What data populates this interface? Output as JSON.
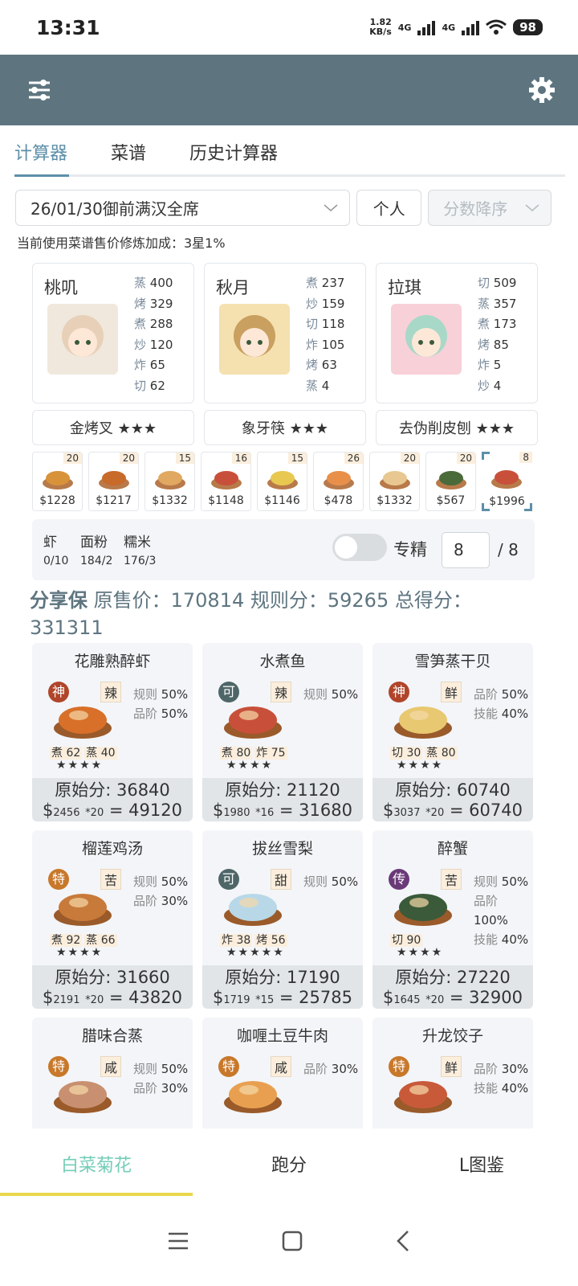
{
  "status": {
    "time": "13:31",
    "speed": "1.82",
    "speed_unit": "KB/s",
    "net1": "4G",
    "net2": "4G",
    "wifi_num": "6",
    "battery": "98"
  },
  "tabs": [
    "计算器",
    "菜谱",
    "历史计算器"
  ],
  "controls": {
    "rule": "26/01/30御前满汉全席",
    "mode": "个人",
    "sort": "分数降序"
  },
  "note": "当前使用菜谱售价修炼加成：3星1%",
  "chefs": [
    {
      "name": "桃叽",
      "skills": [
        [
          "蒸",
          "400"
        ],
        [
          "烤",
          "329"
        ],
        [
          "煮",
          "288"
        ],
        [
          "炒",
          "120"
        ],
        [
          "炸",
          "65"
        ],
        [
          "切",
          "62"
        ]
      ]
    },
    {
      "name": "秋月",
      "skills": [
        [
          "煮",
          "237"
        ],
        [
          "炒",
          "159"
        ],
        [
          "切",
          "118"
        ],
        [
          "炸",
          "105"
        ],
        [
          "烤",
          "63"
        ],
        [
          "蒸",
          "4"
        ]
      ]
    },
    {
      "name": "拉琪",
      "skills": [
        [
          "切",
          "509"
        ],
        [
          "蒸",
          "357"
        ],
        [
          "煮",
          "173"
        ],
        [
          "烤",
          "85"
        ],
        [
          "炸",
          "5"
        ],
        [
          "炒",
          "4"
        ]
      ]
    }
  ],
  "equips": [
    "金烤叉 ★★★",
    "象牙筷 ★★★",
    "去伪削皮刨 ★★★"
  ],
  "dishes": [
    {
      "count": "20",
      "price": "$1228"
    },
    {
      "count": "20",
      "price": "$1217"
    },
    {
      "count": "15",
      "price": "$1332"
    },
    {
      "count": "16",
      "price": "$1148"
    },
    {
      "count": "15",
      "price": "$1146"
    },
    {
      "count": "26",
      "price": "$478"
    },
    {
      "count": "20",
      "price": "$1332"
    },
    {
      "count": "20",
      "price": "$567"
    },
    {
      "count": "8",
      "price": "$1996"
    }
  ],
  "materials": [
    {
      "name": "虾",
      "count": "0/10"
    },
    {
      "name": "面粉",
      "count": "184/2"
    },
    {
      "name": "糯米",
      "count": "176/3"
    }
  ],
  "specialize": {
    "label": "专精",
    "value": "8",
    "max": "/ 8"
  },
  "summary": {
    "prefix": "分享保",
    "text": " 原售价：170814 规则分：59265 总得分：331311"
  },
  "recipes": [
    {
      "name": "花雕熟醉虾",
      "badge": "神",
      "badge_color": "#b0452a",
      "flavor": "辣",
      "tags": [
        [
          "规则",
          "50%"
        ],
        [
          "品阶",
          "50%"
        ]
      ],
      "skills": [
        "煮 62",
        "蒸 40"
      ],
      "stars": "★★★★",
      "raw": "原始分: 36840",
      "unit": "2456",
      "mult": "*20",
      "total": "49120"
    },
    {
      "name": "水煮鱼",
      "badge": "可",
      "badge_color": "#4e6668",
      "flavor": "辣",
      "tags": [
        [
          "规则",
          "50%"
        ]
      ],
      "skills": [
        "煮 80",
        "炸 75"
      ],
      "stars": "★★★★",
      "raw": "原始分: 21120",
      "unit": "1980",
      "mult": "*16",
      "total": "31680"
    },
    {
      "name": "雪笋蒸干贝",
      "badge": "神",
      "badge_color": "#b0452a",
      "flavor": "鲜",
      "tags": [
        [
          "品阶",
          "50%"
        ],
        [
          "技能",
          "40%"
        ]
      ],
      "skills": [
        "切 30",
        "蒸 80"
      ],
      "stars": "★★★★",
      "raw": "原始分: 60740",
      "unit": "3037",
      "mult": "*20",
      "total": "60740"
    },
    {
      "name": "榴莲鸡汤",
      "badge": "特",
      "badge_color": "#c8782a",
      "flavor": "苦",
      "tags": [
        [
          "规则",
          "50%"
        ],
        [
          "品阶",
          "30%"
        ]
      ],
      "skills": [
        "煮 92",
        "蒸 66"
      ],
      "stars": "★★★★",
      "raw": "原始分: 31660",
      "unit": "2191",
      "mult": "*20",
      "total": "43820"
    },
    {
      "name": "拔丝雪梨",
      "badge": "可",
      "badge_color": "#4e6668",
      "flavor": "甜",
      "tags": [
        [
          "规则",
          "50%"
        ]
      ],
      "skills": [
        "炸 38",
        "烤 56"
      ],
      "stars": "★★★★★",
      "raw": "原始分: 17190",
      "unit": "1719",
      "mult": "*15",
      "total": "25785"
    },
    {
      "name": "醉蟹",
      "badge": "传",
      "badge_color": "#6a3a78",
      "flavor": "苦",
      "tags": [
        [
          "规则",
          "50%"
        ],
        [
          "品阶",
          "100%"
        ],
        [
          "技能",
          "40%"
        ]
      ],
      "skills": [
        "切 90"
      ],
      "stars": "★★★★",
      "raw": "原始分: 27220",
      "unit": "1645",
      "mult": "*20",
      "total": "32900"
    },
    {
      "name": "腊味合蒸",
      "badge": "特",
      "badge_color": "#c8782a",
      "flavor": "咸",
      "tags": [
        [
          "规则",
          "50%"
        ],
        [
          "品阶",
          "30%"
        ]
      ],
      "skills": [],
      "stars": "",
      "raw": "",
      "unit": "",
      "mult": "",
      "total": ""
    },
    {
      "name": "咖喱土豆牛肉",
      "badge": "特",
      "badge_color": "#c8782a",
      "flavor": "咸",
      "tags": [
        [
          "品阶",
          "30%"
        ]
      ],
      "skills": [],
      "stars": "",
      "raw": "",
      "unit": "",
      "mult": "",
      "total": ""
    },
    {
      "name": "升龙饺子",
      "badge": "特",
      "badge_color": "#c8782a",
      "flavor": "鲜",
      "tags": [
        [
          "品阶",
          "30%"
        ],
        [
          "技能",
          "40%"
        ]
      ],
      "skills": [],
      "stars": "",
      "raw": "",
      "unit": "",
      "mult": "",
      "total": ""
    }
  ],
  "bottom_nav": [
    "白菜菊花",
    "跑分",
    "L图鉴"
  ],
  "colors": {
    "header": "#5e7580",
    "accent": "#5e8fa8",
    "active_nav": "#74cdb8",
    "nav_indicator": "#e8d84a"
  }
}
